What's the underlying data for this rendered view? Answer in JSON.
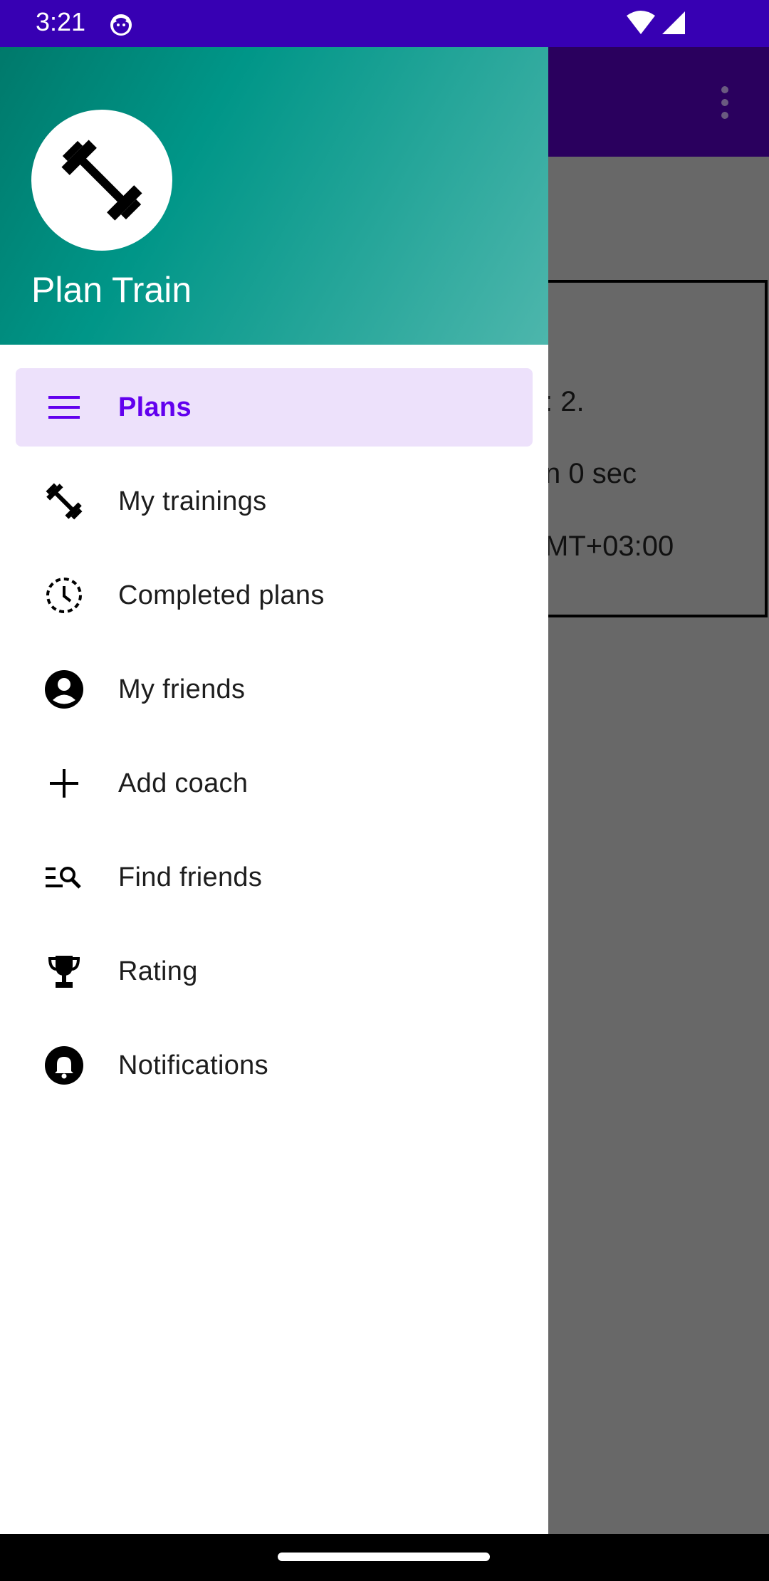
{
  "status_bar": {
    "time": "3:21",
    "color": "#3700B3"
  },
  "background": {
    "app_bar_color": "#2A005E",
    "card_lines": [
      ": 2.",
      "n 0 sec",
      "MT+03:00"
    ]
  },
  "drawer": {
    "app_name": "Plan Train",
    "header_gradient": [
      "#00796B",
      "#009688",
      "#4DB6AC"
    ],
    "items": [
      {
        "label": "Plans",
        "icon": "menu-icon",
        "active": true
      },
      {
        "label": "My trainings",
        "icon": "dumbbell-icon",
        "active": false
      },
      {
        "label": "Completed plans",
        "icon": "clock-dashed-icon",
        "active": false
      },
      {
        "label": "My friends",
        "icon": "account-circle-icon",
        "active": false
      },
      {
        "label": "Add coach",
        "icon": "plus-icon",
        "active": false
      },
      {
        "label": "Find friends",
        "icon": "list-search-icon",
        "active": false
      },
      {
        "label": "Rating",
        "icon": "trophy-icon",
        "active": false
      },
      {
        "label": "Notifications",
        "icon": "bell-icon",
        "active": false
      }
    ],
    "accent_color": "#6200EE",
    "active_bg": "#EDE1FB"
  }
}
